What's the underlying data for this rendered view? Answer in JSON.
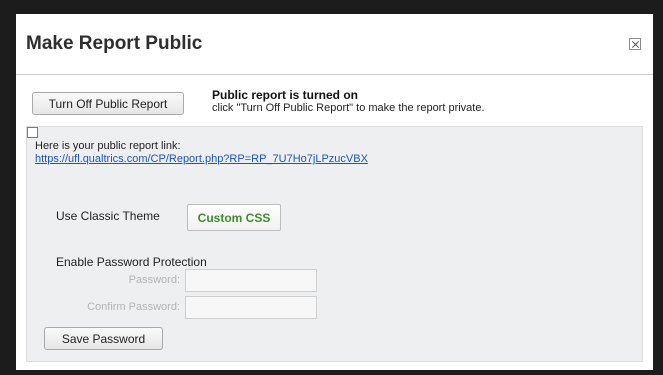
{
  "dialog": {
    "title": "Make Report Public",
    "close_icon": "close-icon"
  },
  "status": {
    "turn_off_label": "Turn Off Public Report",
    "heading": "Public report is turned on",
    "description": "click \"Turn Off Public Report\" to make the report private."
  },
  "link": {
    "label": "Here is your public report link:",
    "url": "https://ufl.qualtrics.com/CP/Report.php?RP=RP_7U7Ho7jLPzucVBX"
  },
  "theme": {
    "classic_label": "Use Classic Theme",
    "classic_checked": true,
    "custom_css_label": "Custom CSS",
    "custom_css_color": "#3a8f2a"
  },
  "password": {
    "enable_label": "Enable Password Protection",
    "enable_checked": false,
    "password_label": "Password:",
    "confirm_label": "Confirm Password:",
    "password_value": "",
    "confirm_value": "",
    "save_label": "Save Password"
  },
  "colors": {
    "link": "#1a55c8",
    "panel_bg": "#eeeff0",
    "overlay": "#1c1c1c"
  }
}
